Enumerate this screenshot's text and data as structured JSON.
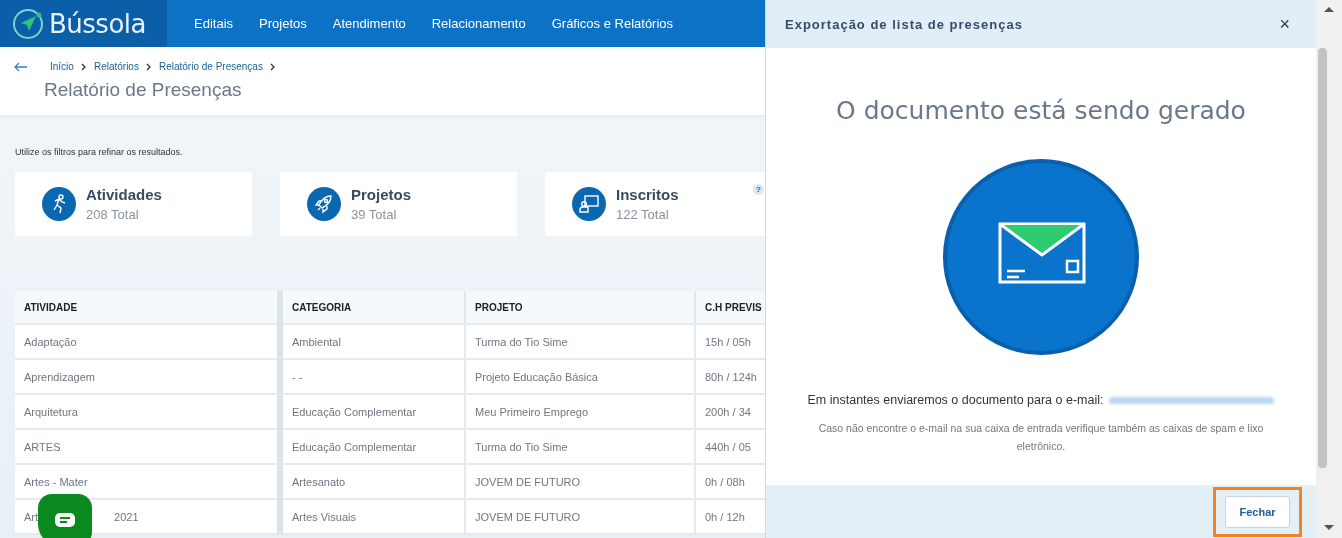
{
  "header": {
    "logo": "Bússola",
    "nav": [
      {
        "label": "Editais"
      },
      {
        "label": "Projetos"
      },
      {
        "label": "Atendimento"
      },
      {
        "label": "Relacionamento"
      },
      {
        "label": "Gráficos e Relatórios"
      }
    ]
  },
  "breadcrumb": [
    "Início",
    "Relatórios",
    "Relatório de Presenças"
  ],
  "page_title": "Relatório de Presenças",
  "filter_hint": "Utilize os filtros para refinar os resultados.",
  "stats": [
    {
      "kind": "activity",
      "title": "Atividades",
      "total": "208 Total"
    },
    {
      "kind": "rocket",
      "title": "Projetos",
      "total": "39 Total"
    },
    {
      "kind": "student",
      "title": "Inscritos",
      "total": "122 Total",
      "help": "?"
    }
  ],
  "table": {
    "columns": [
      "ATIVIDADE",
      "CATEGORIA",
      "PROJETO",
      "C.H PREVIS"
    ],
    "rows": [
      {
        "cells": [
          "Adaptação",
          "Ambiental",
          "Turma do Tio Sime",
          "15h / 05h"
        ]
      },
      {
        "cells": [
          "Aprendizagem",
          "- -",
          "Projeto Educação Básica",
          "80h / 124h"
        ]
      },
      {
        "cells": [
          "Arquitetura",
          "Educação Complementar",
          "Meu Primeiro Emprego",
          "200h / 34"
        ]
      },
      {
        "cells": [
          "ARTES",
          "Educação Complementar",
          "Turma do Tio Sime",
          "440h / 05"
        ]
      },
      {
        "cells": [
          "Artes - Mater",
          "Artesanato",
          "JOVEM DE FUTURO",
          "0h / 08h"
        ]
      },
      {
        "cells": [
          "Art",
          "Artes Visuais",
          "JOVEM DE FUTURO",
          "0h / 12h"
        ],
        "fragment": "2021"
      }
    ]
  },
  "modal": {
    "title": "Exportação de lista de presenças",
    "close": "×",
    "heading": "O documento está sendo gerado",
    "message": "Em instantes enviaremos o documento para o e-mail:",
    "note": "Caso não encontre o e-mail na sua caixa de entrada verifique também as caixas de spam e lixo eletrônico.",
    "buttons": [
      "Fechar"
    ]
  }
}
